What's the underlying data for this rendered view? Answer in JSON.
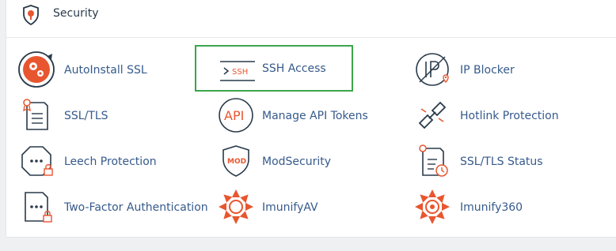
{
  "section": {
    "title": "Security",
    "header_icon": "shield-icon"
  },
  "items": [
    {
      "label": "AutoInstall SSL",
      "icon": "autoinstall-ssl-icon"
    },
    {
      "label": "SSH Access",
      "icon": "terminal-ssh-icon",
      "highlighted": true
    },
    {
      "label": "IP Blocker",
      "icon": "ip-blocker-icon"
    },
    {
      "label": "SSL/TLS",
      "icon": "ssl-certificate-icon"
    },
    {
      "label": "Manage API Tokens",
      "icon": "api-icon"
    },
    {
      "label": "Hotlink Protection",
      "icon": "broken-link-icon"
    },
    {
      "label": "Leech Protection",
      "icon": "password-lock-icon"
    },
    {
      "label": "ModSecurity",
      "icon": "mod-shield-icon"
    },
    {
      "label": "SSL/TLS Status",
      "icon": "ssl-status-icon"
    },
    {
      "label": "Two-Factor Authentication",
      "icon": "two-factor-icon"
    },
    {
      "label": "ImunifyAV",
      "icon": "imunify-av-icon"
    },
    {
      "label": "Imunify360",
      "icon": "imunify360-icon"
    }
  ],
  "colors": {
    "link": "#365a8c",
    "icon_stroke": "#293a4a",
    "accent_orange": "#e8562f",
    "highlight_border": "#3aa64a"
  },
  "ssh_icon_text": "SSH",
  "api_icon_text": "API",
  "mod_icon_text": "MOD"
}
